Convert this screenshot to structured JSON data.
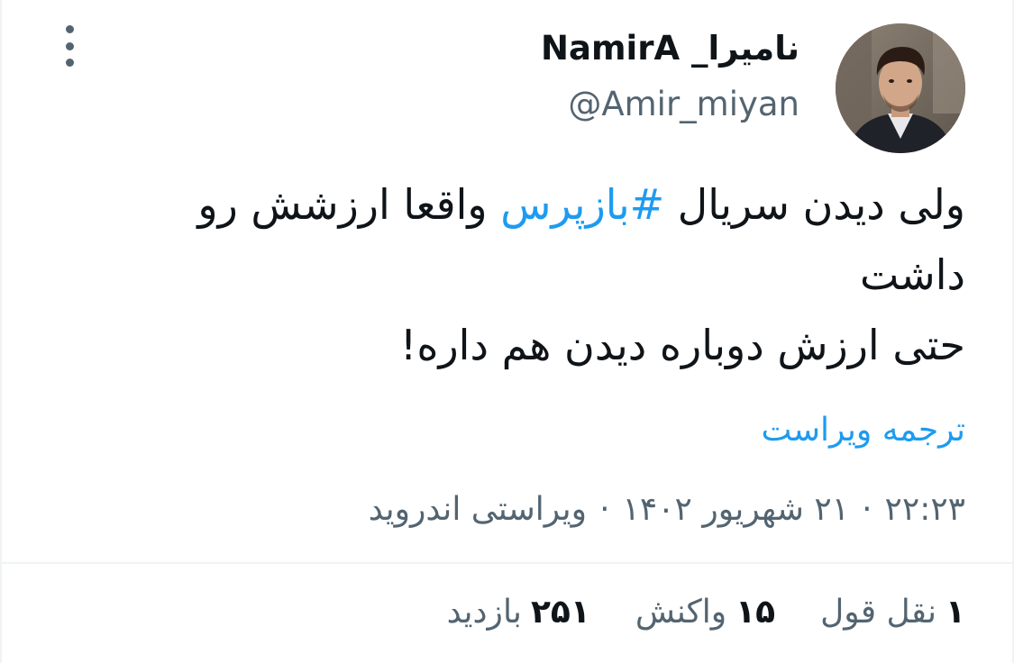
{
  "author": {
    "display_name": "نامیرا_ NamirA",
    "handle": "@Amir_miyan"
  },
  "tweet": {
    "line1_before": "ولی دیدن سریال ",
    "hashtag": "#بازپرس",
    "line1_after": " واقعا ارزشش رو",
    "line2": "داشت",
    "line3": "حتی ارزش دوباره دیدن هم داره!",
    "translate_label": "ترجمه ویراست"
  },
  "meta": {
    "time": "۲۲:۲۳",
    "date": "۲۱ شهریور ۱۴۰۲",
    "source": "ویراستی اندروید",
    "separator": "·"
  },
  "stats": [
    {
      "count": "۱",
      "label": "نقل قول"
    },
    {
      "count": "۱۵",
      "label": "واکنش"
    },
    {
      "count": "۲۵۱",
      "label": "بازدید"
    }
  ],
  "colors": {
    "link": "#1d9bf0",
    "secondary_text": "#536471",
    "primary_text": "#0f1419"
  },
  "icons": {
    "more": "more-vertical-icon"
  }
}
